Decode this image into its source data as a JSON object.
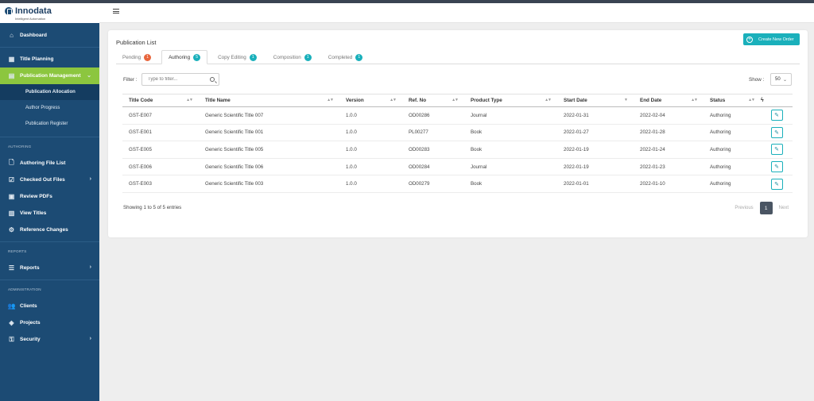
{
  "brand": {
    "name": "Innodata",
    "tagline": "Intelligent Automation"
  },
  "sidebar": {
    "items": [
      {
        "label": "Dashboard",
        "icon": "home-icon"
      },
      {
        "label": "Title Planning",
        "icon": "calendar-icon"
      },
      {
        "label": "Publication Management",
        "icon": "book-icon",
        "active": true
      },
      {
        "label": "Publication Allocation",
        "sub": true,
        "current": true
      },
      {
        "label": "Author Progress",
        "sub": true
      },
      {
        "label": "Publication Register",
        "sub": true
      }
    ],
    "sections": {
      "authoring": "AUTHORING",
      "reports": "REPORTS",
      "administration": "ADMINISTRATION"
    },
    "authoring_items": [
      {
        "label": "Authoring File List",
        "icon": "file-icon"
      },
      {
        "label": "Checked Out Files",
        "icon": "checkbox-icon",
        "chevron": true
      },
      {
        "label": "Review PDFs",
        "icon": "pdf-icon"
      },
      {
        "label": "View Titles",
        "icon": "books-icon"
      },
      {
        "label": "Reference Changes",
        "icon": "gear-icon"
      }
    ],
    "reports_items": [
      {
        "label": "Reports",
        "icon": "list-icon",
        "chevron": true
      }
    ],
    "admin_items": [
      {
        "label": "Clients",
        "icon": "users-icon"
      },
      {
        "label": "Projects",
        "icon": "tag-icon"
      },
      {
        "label": "Security",
        "icon": "key-icon",
        "chevron": true
      }
    ]
  },
  "main": {
    "title": "Publication List",
    "create_button": "Create New Order",
    "tabs": [
      {
        "label": "Pending",
        "count": "1",
        "color": "#e8663d"
      },
      {
        "label": "Authoring",
        "count": "5",
        "color": "#1ab0bb",
        "active": true
      },
      {
        "label": "Copy Editing",
        "count": "1",
        "color": "#1ab0bb"
      },
      {
        "label": "Composition",
        "count": "1",
        "color": "#1ab0bb"
      },
      {
        "label": "Completed",
        "count": "1",
        "color": "#1ab0bb"
      }
    ],
    "filter_label": "Filter :",
    "filter_placeholder": "Type to filter...",
    "show_label": "Show :",
    "show_value": "50",
    "columns": [
      "Title Code",
      "Title Name",
      "Version",
      "Ref. No",
      "Product Type",
      "Start Date",
      "End Date",
      "Status"
    ],
    "rows": [
      [
        "GST-E007",
        "Generic Scientific Title 007",
        "1.0.0",
        "OD00286",
        "Journal",
        "2022-01-31",
        "2022-02-04",
        "Authoring"
      ],
      [
        "GST-E001",
        "Generic Scientific Title 001",
        "1.0.0",
        "PL00277",
        "Book",
        "2022-01-27",
        "2022-01-28",
        "Authoring"
      ],
      [
        "GST-E005",
        "Generic Scientific Title 005",
        "1.0.0",
        "OD00283",
        "Book",
        "2022-01-19",
        "2022-01-24",
        "Authoring"
      ],
      [
        "GST-E006",
        "Generic Scientific Title 006",
        "1.0.0",
        "OD00284",
        "Journal",
        "2022-01-19",
        "2022-01-23",
        "Authoring"
      ],
      [
        "GST-E003",
        "Generic Scientific Title 003",
        "1.0.0",
        "OD00279",
        "Book",
        "2022-01-01",
        "2022-01-10",
        "Authoring"
      ]
    ],
    "info": "Showing 1 to 5 of 5 entries",
    "pager": {
      "prev": "Previous",
      "current": "1",
      "next": "Next"
    }
  }
}
